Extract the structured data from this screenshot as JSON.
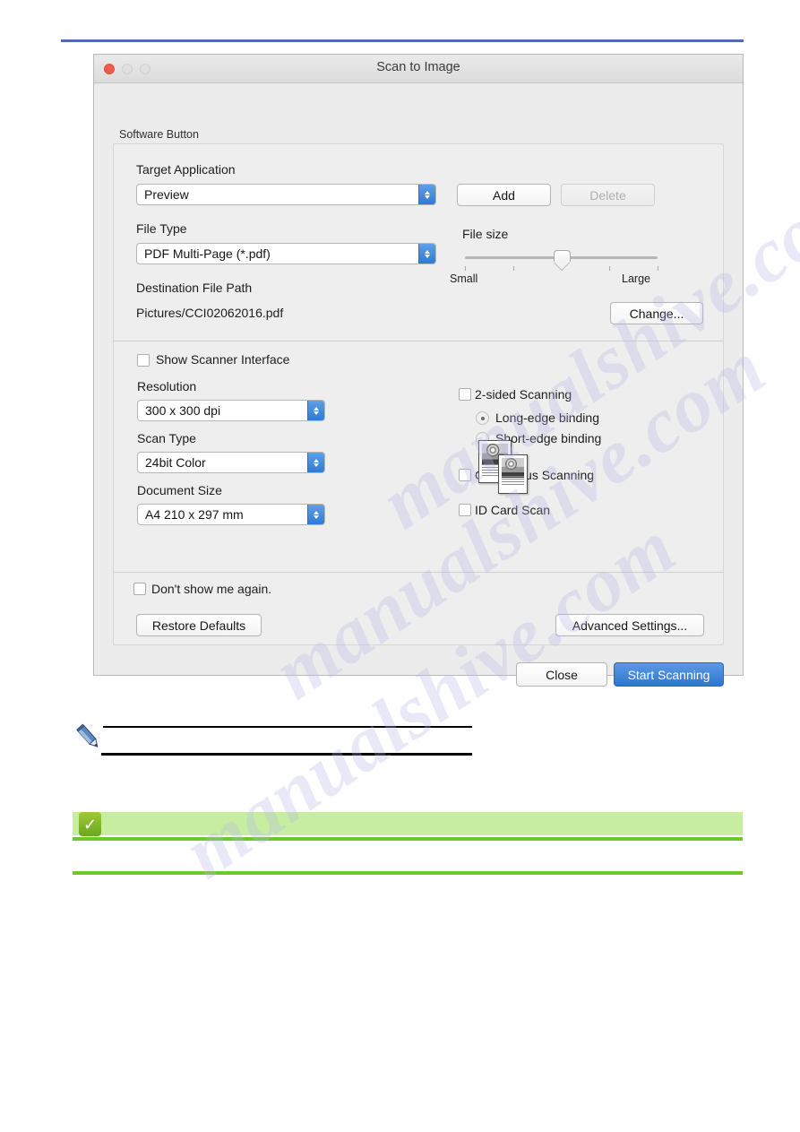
{
  "window": {
    "title": "Scan to Image",
    "traffic_lights": [
      "close-red",
      "minimize-gray",
      "zoom-gray"
    ]
  },
  "group": {
    "label": "Software Button"
  },
  "target_application": {
    "label": "Target Application",
    "value": "Preview",
    "add_label": "Add",
    "delete_label": "Delete",
    "delete_disabled": true
  },
  "file_type": {
    "label": "File Type",
    "value": "PDF Multi-Page (*.pdf)"
  },
  "file_size": {
    "label": "File size",
    "min_label": "Small",
    "max_label": "Large",
    "ticks": 5,
    "value_position": 3
  },
  "destination": {
    "label": "Destination File Path",
    "value": "Pictures/CCI02062016.pdf",
    "change_label": "Change..."
  },
  "scanner_interface": {
    "label": "Show Scanner Interface",
    "checked": false
  },
  "resolution": {
    "label": "Resolution",
    "value": "300 x 300 dpi"
  },
  "scan_type": {
    "label": "Scan Type",
    "value": "24bit Color"
  },
  "document_size": {
    "label": "Document Size",
    "value": "A4 210 x 297 mm"
  },
  "options": {
    "two_sided": {
      "label": "2-sided Scanning",
      "checked": false
    },
    "long_edge": {
      "label": "Long-edge binding",
      "selected": true
    },
    "short_edge": {
      "label": "Short-edge binding",
      "selected": false
    },
    "continuous": {
      "label": "Continuous Scanning",
      "checked": false
    },
    "id_card": {
      "label": "ID Card Scan",
      "checked": false
    }
  },
  "footer": {
    "dont_show_label": "Don't show me again.",
    "dont_show_checked": false,
    "restore_defaults_label": "Restore Defaults",
    "advanced_settings_label": "Advanced Settings...",
    "close_label": "Close",
    "start_scanning_label": "Start Scanning"
  },
  "watermark": {
    "line1": "manualshive.com",
    "line2": "manualshive.com",
    "line3": "manualshive.com"
  },
  "colors": {
    "top_rule": "#4f6bb5",
    "accent_blue": "#2f75cf",
    "stepper_blue": "#2e7ad6",
    "green_rule": "#6ec82a",
    "green_bar": "#c7eda1",
    "close_red": "#f05a4a"
  },
  "check_badge": {
    "glyph": "✓"
  }
}
